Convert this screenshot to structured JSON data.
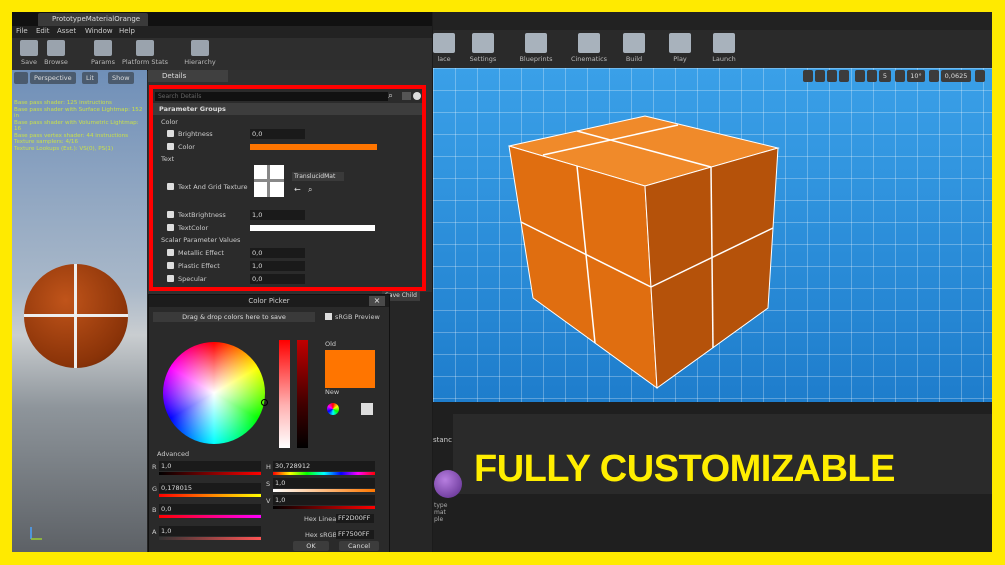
{
  "window_tab": "PrototypeMaterialOrange",
  "menu": [
    "File",
    "Edit",
    "Asset",
    "Window",
    "Help"
  ],
  "toolbar": [
    {
      "label": "Save",
      "icon": "save-icon"
    },
    {
      "label": "Browse",
      "icon": "browse-icon"
    },
    {
      "label": "Params",
      "icon": "params-icon"
    },
    {
      "label": "Platform Stats",
      "icon": "platform-stats-icon"
    },
    {
      "label": "Hierarchy",
      "icon": "hierarchy-icon"
    }
  ],
  "viewport_buttons": [
    "Perspective",
    "Lit",
    "Show"
  ],
  "shader_stats": [
    "Base pass shader: 125 instructions",
    "Base pass shader with Surface Lightmap: 152 in",
    "Base pass shader with Volumetric Lightmap: 16",
    "Base pass vertex shader: 44 instructions",
    "Texture samplers: 4/16",
    "Texture Lookups (Est.): VS(0), PS(1)"
  ],
  "details": {
    "tab": "Details",
    "search_placeholder": "Search Details",
    "section": "Parameter Groups",
    "groups": {
      "color": "Color",
      "text": "Text",
      "scalar": "Scalar Parameter Values"
    },
    "params": {
      "brightness": {
        "label": "Brightness",
        "value": "0,0"
      },
      "color": {
        "label": "Color",
        "swatch": "#ff7500"
      },
      "text_grid_texture": {
        "label": "Text And Grid Texture",
        "asset": "TranslucidMat"
      },
      "text_brightness": {
        "label": "TextBrightness",
        "value": "1,0"
      },
      "text_color": {
        "label": "TextColor",
        "swatch": "#ffffff"
      },
      "metallic": {
        "label": "Metallic Effect",
        "value": "0,0"
      },
      "plastic": {
        "label": "Plastic Effect",
        "value": "1,0"
      },
      "specular": {
        "label": "Specular",
        "value": "0,0"
      }
    }
  },
  "color_picker": {
    "title": "Color Picker",
    "drag_drop": "Drag & drop colors here to save",
    "srgb_preview": "sRGB Preview",
    "old_label": "Old",
    "new_label": "New",
    "advanced": "Advanced",
    "r": {
      "label": "R",
      "value": "1,0"
    },
    "g": {
      "label": "G",
      "value": "0,178015"
    },
    "b": {
      "label": "B",
      "value": "0,0"
    },
    "a": {
      "label": "A",
      "value": "1,0"
    },
    "h": {
      "label": "H",
      "value": "30,728912"
    },
    "s": {
      "label": "S",
      "value": "1,0"
    },
    "v": {
      "label": "V",
      "value": "1,0"
    },
    "hex_linear": {
      "label": "Hex Linear",
      "value": "FF2D00FF"
    },
    "hex_srgb": {
      "label": "Hex sRGB",
      "value": "FF7500FF"
    },
    "ok": "OK",
    "cancel": "Cancel",
    "old_color": "#ff7500"
  },
  "save_child": "Save Child",
  "right_toolbar": [
    {
      "label": "lace",
      "icon": "place-icon"
    },
    {
      "label": "Settings",
      "icon": "settings-icon"
    },
    {
      "label": "Blueprints",
      "icon": "blueprints-icon"
    },
    {
      "label": "Cinematics",
      "icon": "cinematics-icon"
    },
    {
      "label": "Build",
      "icon": "build-icon"
    },
    {
      "label": "Play",
      "icon": "play-icon"
    },
    {
      "label": "Launch",
      "icon": "launch-icon"
    }
  ],
  "viewport_values": {
    "grid": "5",
    "angle": "10°",
    "scale": "0,0625"
  },
  "lower_panel": {
    "label": "stanc",
    "side_text": [
      "type",
      "mat",
      "ple"
    ]
  },
  "banner": "FULLY CUSTOMIZABLE"
}
